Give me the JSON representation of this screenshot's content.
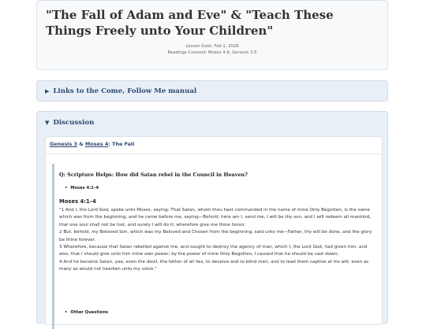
{
  "lesson": {
    "title": "\"The Fall of Adam and Eve\" & \"Teach These Things Freely unto Your Children\"",
    "date": "Lesson Date: Feb 1, 2026",
    "readings": "Readings Covered: Moses 4-6, Genesis 3-5"
  },
  "links_section": {
    "icon": "triangle-right",
    "label": "Links to the Come, Follow Me manual"
  },
  "discussion": {
    "icon": "triangle-down",
    "label": "Discussion",
    "subsection": {
      "ref1": "Genesis 3",
      "amp": "&",
      "ref2": "Moses 4",
      "suffix": ": The Fall"
    },
    "question": "Q: Scripture Helps: How did Satan rebel in the Council in Heaven?",
    "bullet_ref": "Moses 4:1–4",
    "passage_title": "Moses 4:1–4",
    "verses": [
      "\"1 And I, the Lord God, spake unto Moses, saying: That Satan, whom thou hast commanded in the name of mine Only Begotten, is the same which was from the beginning, and he came before me, saying—Behold, here am I, send me, I will be thy son, and I will redeem all mankind, that one soul shall not be lost, and surely I will do it; wherefore give me thine honor.",
      "2 But, behold, my Beloved Son, which was my Beloved and Chosen from the beginning, said unto me—Father, thy will be done, and the glory be thine forever.",
      "3 Wherefore, because that Satan rebelled against me, and sought to destroy the agency of man, which I, the Lord God, had given him, and also, that I should give unto him mine own power; by the power of mine Only Begotten, I caused that he should be cast down;",
      "4 And he became Satan, yea, even the devil, the father of all lies, to deceive and to blind men, and to lead them captive at his will, even as many as would not hearken unto my voice.\""
    ],
    "other_questions": "Other Questions"
  }
}
